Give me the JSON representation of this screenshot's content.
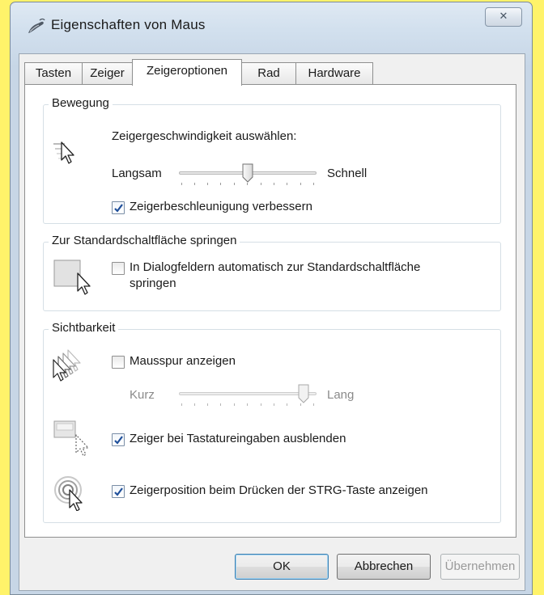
{
  "window": {
    "title": "Eigenschaften von Maus",
    "close_glyph": "✕"
  },
  "tabs": [
    {
      "label": "Tasten"
    },
    {
      "label": "Zeiger"
    },
    {
      "label": "Zeigeroptionen"
    },
    {
      "label": "Rad"
    },
    {
      "label": "Hardware"
    }
  ],
  "active_tab": "Zeigeroptionen",
  "motion": {
    "group_label": "Bewegung",
    "speed_prompt": "Zeigergeschwindigkeit auswählen:",
    "slow_label": "Langsam",
    "fast_label": "Schnell",
    "speed_level": 0.5,
    "enhance_precision_label": "Zeigerbeschleunigung verbessern",
    "enhance_precision_checked": true,
    "icon": "pointer-speed-icon"
  },
  "snap_to": {
    "group_label": "Zur Standardschaltfläche springen",
    "checkbox_label_line1": "In Dialogfeldern automatisch zur Standardschaltfläche",
    "checkbox_label_line2": "springen",
    "checked": false,
    "icon": "snap-to-default-icon"
  },
  "visibility": {
    "group_label": "Sichtbarkeit",
    "trails_label": "Mausspur anzeigen",
    "trails_checked": false,
    "short_label": "Kurz",
    "long_label": "Lang",
    "trail_length_level": 0.85,
    "hide_while_typing_label": "Zeiger bei Tastatureingaben ausblenden",
    "hide_while_typing_checked": true,
    "show_location_label": "Zeigerposition beim Drücken der STRG-Taste anzeigen",
    "show_location_checked": true,
    "icons": [
      "pointer-trails-icon",
      "hide-pointer-icon",
      "pointer-location-icon"
    ]
  },
  "buttons": {
    "ok": "OK",
    "cancel": "Abbrechen",
    "apply": "Übernehmen"
  },
  "colors": {
    "desktop_background": "#fff36a",
    "checkmark": "#1f4f9a"
  }
}
